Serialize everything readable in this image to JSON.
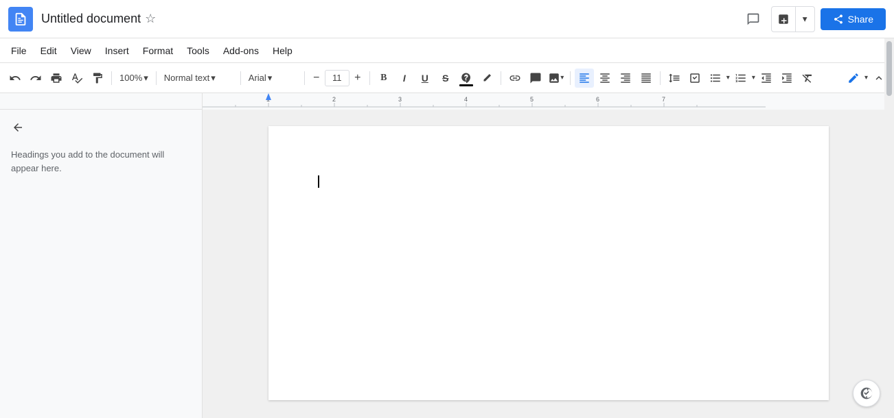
{
  "titleBar": {
    "appName": "Google Docs",
    "docTitle": "Untitled document",
    "shareLabel": "Share"
  },
  "menuBar": {
    "items": [
      "File",
      "Edit",
      "View",
      "Insert",
      "Format",
      "Tools",
      "Add-ons",
      "Help"
    ]
  },
  "toolbar": {
    "zoomLevel": "100%",
    "paragraphStyle": "Normal text",
    "fontFamily": "Arial",
    "fontSize": "11",
    "decreaseFontLabel": "−",
    "increaseFontLabel": "+"
  },
  "sidebar": {
    "hintText": "Headings you add to the document will appear here."
  },
  "document": {
    "content": ""
  },
  "icons": {
    "undo": "↩",
    "redo": "↪",
    "print": "🖶",
    "paintFormat": "🖌",
    "star": "☆",
    "back": "←",
    "lock": "🔒",
    "comments": "💬",
    "add": "＋",
    "chevronDown": "▾",
    "bold": "B",
    "italic": "I",
    "underline": "U",
    "strikethrough": "S",
    "highlight": "A",
    "link": "🔗",
    "comment": "💬",
    "image": "🖼",
    "alignLeft": "≡",
    "alignCenter": "≡",
    "alignRight": "≡",
    "justify": "≡",
    "lineSpacing": "↕",
    "checklist": "☑",
    "bulletList": "•",
    "numberedList": "#",
    "decreaseIndent": "⇤",
    "increaseIndent": "⇥",
    "clearFormatting": "✕",
    "editWithAI": "✏",
    "expand": "❯"
  }
}
